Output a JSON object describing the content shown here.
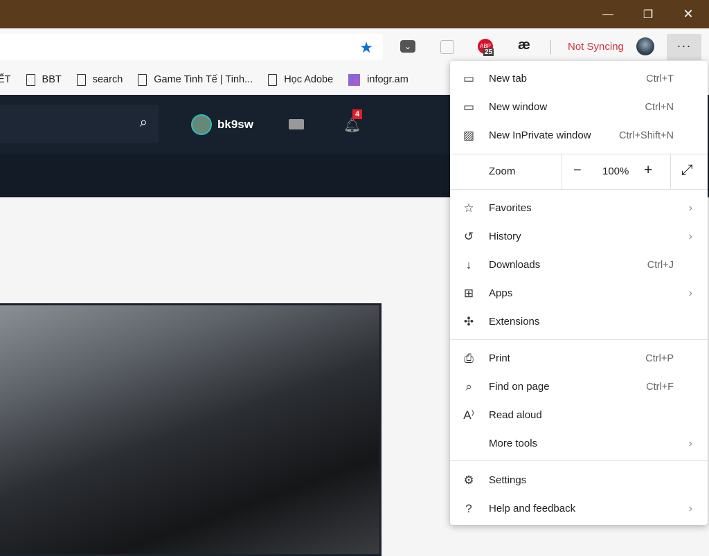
{
  "window": {
    "minimize": "—",
    "restore": "❐",
    "close": "✕"
  },
  "toolbar": {
    "extensions": [
      {
        "name": "pocket-icon",
        "label": "⌄"
      },
      {
        "name": "readlater-icon",
        "label": "▢"
      },
      {
        "name": "adblock-icon",
        "label": "ABP",
        "badge": "25"
      },
      {
        "name": "ae-icon",
        "label": "æ"
      }
    ],
    "sync": "Not Syncing",
    "more": "···",
    "sync_color": "#d13438"
  },
  "bookmarks": [
    "ẾT",
    "BBT",
    "search",
    "Game Tinh Tế | Tinh...",
    "Học Adobe",
    "infogr.am"
  ],
  "site": {
    "username": "bk9sw",
    "notifications": "4"
  },
  "menu": {
    "items": [
      {
        "icon": "new-tab-icon",
        "glyph": "▭",
        "label": "New tab",
        "shortcut": "Ctrl+T"
      },
      {
        "icon": "new-window-icon",
        "glyph": "▭",
        "label": "New window",
        "shortcut": "Ctrl+N"
      },
      {
        "icon": "inprivate-icon",
        "glyph": "▨",
        "label": "New InPrivate window",
        "shortcut": "Ctrl+Shift+N"
      }
    ],
    "zoom": {
      "label": "Zoom",
      "minus": "−",
      "value": "100%",
      "plus": "+",
      "fullscreen": "⤢"
    },
    "items2": [
      {
        "icon": "favorites-icon",
        "glyph": "☆",
        "label": "Favorites",
        "arrow": "›"
      },
      {
        "icon": "history-icon",
        "glyph": "↺",
        "label": "History",
        "arrow": "›"
      },
      {
        "icon": "downloads-icon",
        "glyph": "↓",
        "label": "Downloads",
        "shortcut": "Ctrl+J"
      },
      {
        "icon": "apps-icon",
        "glyph": "⊞",
        "label": "Apps",
        "arrow": "›"
      },
      {
        "icon": "extensions-icon",
        "glyph": "✣",
        "label": "Extensions"
      }
    ],
    "items3": [
      {
        "icon": "print-icon",
        "glyph": "⎙",
        "label": "Print",
        "shortcut": "Ctrl+P"
      },
      {
        "icon": "find-icon",
        "glyph": "⌕",
        "label": "Find on page",
        "shortcut": "Ctrl+F"
      },
      {
        "icon": "read-aloud-icon",
        "glyph": "A⁾",
        "label": "Read aloud"
      },
      {
        "icon": "",
        "glyph": "",
        "label": "More tools",
        "arrow": "›"
      }
    ],
    "items4": [
      {
        "icon": "settings-icon",
        "glyph": "⚙",
        "label": "Settings"
      },
      {
        "icon": "help-icon",
        "glyph": "?",
        "label": "Help and feedback",
        "arrow": "›"
      }
    ]
  }
}
